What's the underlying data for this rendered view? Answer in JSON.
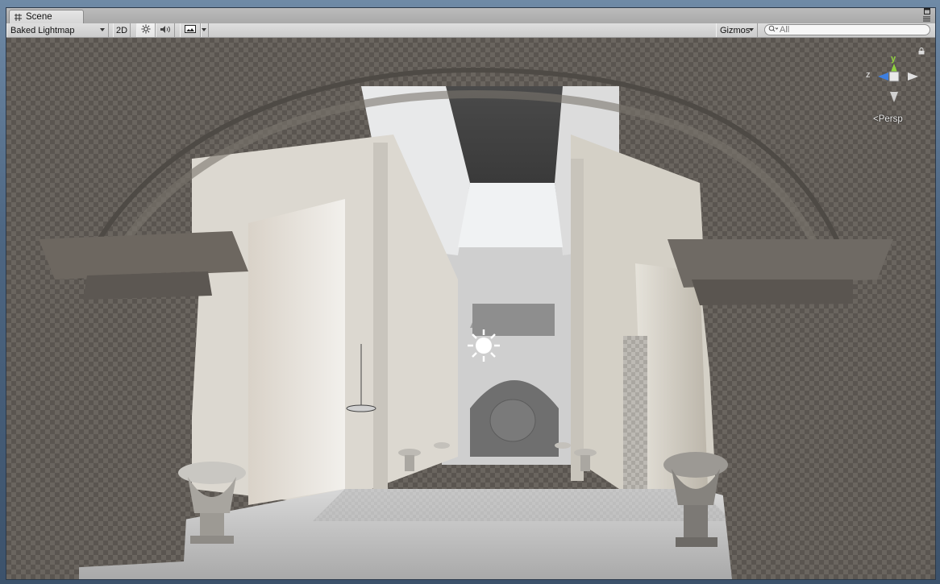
{
  "window": {
    "tab": {
      "label": "Scene",
      "icon": "grid-icon"
    },
    "menu_icon": "panel-menu-icon"
  },
  "toolbar": {
    "render_mode": "Baked Lightmap",
    "mode_2d": "2D",
    "lighting_icon": "sun-icon",
    "audio_icon": "speaker-icon",
    "effects_icon": "image-icon",
    "gizmos": "Gizmos",
    "search_placeholder": "All"
  },
  "scene": {
    "projection": "Persp",
    "gizmo_axes": {
      "y": "y",
      "z": "z"
    },
    "colors": {
      "y_axis": "#8fd13f",
      "z_axis": "#3d7fe0",
      "x_axis": "#e0e0e0",
      "light_icon": "#ffffff"
    }
  }
}
